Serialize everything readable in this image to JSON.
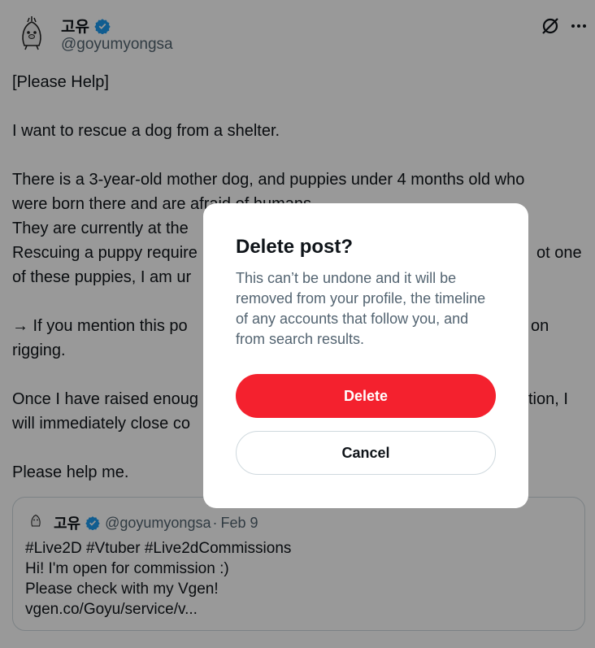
{
  "post": {
    "display_name": "고유",
    "handle": "@goyumyongsa",
    "paragraphs": [
      [
        "[Please Help]"
      ],
      [
        "I want to rescue a dog from a shelter."
      ],
      [
        "There is a 3-year-old mother dog, and puppies under 4 months old who",
        "were born there and are afraid of humans.",
        "They are currently at the",
        "Rescuing a puppy require",
        "of these puppies, I am ur"
      ],
      [
        "→ If you mention this po",
        "rigging."
      ],
      [
        "Once I have raised enoug",
        "will immediately close co"
      ],
      [
        "Please help me."
      ]
    ],
    "right_fragments": {
      "line_ot_one": "ot one",
      "line_on": "on",
      "line_tion_i": "tion, I"
    }
  },
  "quote": {
    "display_name": "고유",
    "handle": "@goyumyongsa",
    "separator": "·",
    "date": "Feb 9",
    "lines": [
      "#Live2D #Vtuber #Live2dCommissions",
      "Hi! I'm open for commission :)",
      "Please check with my Vgen!",
      "vgen.co/Goyu/service/v..."
    ]
  },
  "dialog": {
    "title": "Delete post?",
    "description": "This can’t be undone and it will be removed from your profile, the timeline of any accounts that follow you, and from search results.",
    "delete_label": "Delete",
    "cancel_label": "Cancel"
  },
  "colors": {
    "accent_red": "#f4212e",
    "verified_blue": "#1d9bf0",
    "secondary_text": "#536471"
  },
  "icons": [
    "avatar",
    "verified-badge-icon",
    "grok-icon",
    "more-icon"
  ]
}
